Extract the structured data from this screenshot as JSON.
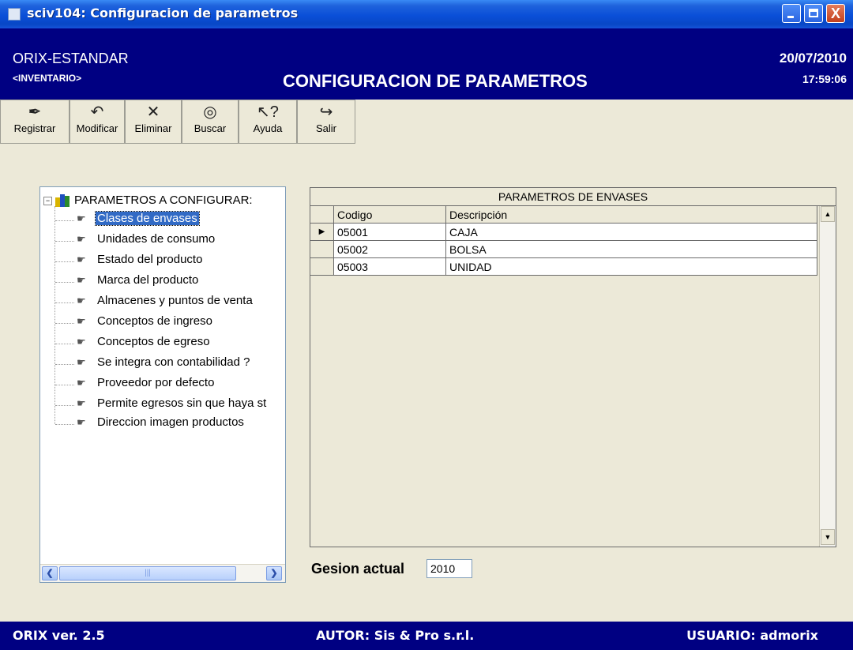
{
  "window": {
    "title": "sciv104: Configuracion de parametros",
    "min_label": "_",
    "max_label": "□",
    "close_label": "X"
  },
  "header": {
    "company": "ORIX-ESTANDAR",
    "module": "<INVENTARIO>",
    "screen_title": "CONFIGURACION DE PARAMETROS",
    "date": "20/07/2010",
    "time": "17:59:06"
  },
  "toolbar": [
    {
      "label": "Registrar",
      "icon": "register-icon"
    },
    {
      "label": "Modificar",
      "icon": "undo-icon"
    },
    {
      "label": "Eliminar",
      "icon": "delete-icon"
    },
    {
      "label": "Buscar",
      "icon": "binoculars-icon"
    },
    {
      "label": "Ayuda",
      "icon": "help-icon"
    },
    {
      "label": "Salir",
      "icon": "exit-icon"
    }
  ],
  "tree": {
    "root_label": "PARAMETROS A CONFIGURAR:",
    "items": [
      "Clases de envases",
      "Unidades de consumo",
      "Estado del producto",
      "Marca del producto",
      "Almacenes y puntos de venta",
      "Conceptos de ingreso",
      "Conceptos de egreso",
      "Se integra con contabilidad ?",
      "Proveedor por defecto",
      "Permite egresos sin que haya st",
      "Direccion imagen productos"
    ],
    "selected_index": 0
  },
  "grid": {
    "caption": "PARAMETROS DE ENVASES",
    "columns": [
      "Codigo",
      "Descripción"
    ],
    "rows": [
      [
        "05001",
        "CAJA"
      ],
      [
        "05002",
        "BOLSA"
      ],
      [
        "05003",
        "UNIDAD"
      ]
    ],
    "current_row": 0
  },
  "gestion": {
    "label": "Gesion actual",
    "value": "2010"
  },
  "status": {
    "version": "ORIX ver. 2.5",
    "author": "AUTOR: Sis & Pro s.r.l.",
    "user": "USUARIO: admorix"
  },
  "colors": {
    "header_bg": "#000082",
    "selection": "#316ac5",
    "face": "#ece9d8"
  }
}
